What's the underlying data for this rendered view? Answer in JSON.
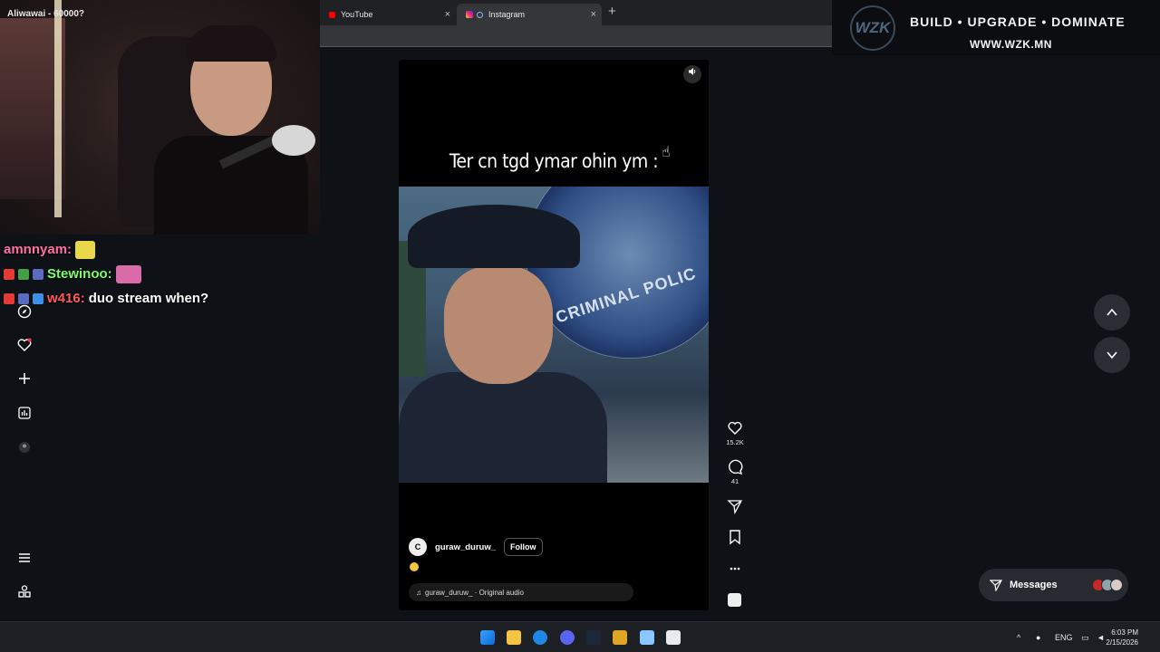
{
  "browser": {
    "tabs": [
      {
        "label": "YouTube",
        "icon": "youtube-icon"
      },
      {
        "label": "Instagram",
        "icon": "instagram-icon"
      }
    ],
    "new_tab": "+",
    "close": "×"
  },
  "webcam": {
    "overlay_text": "Aliwawai - 60000?"
  },
  "chat": {
    "messages": [
      {
        "user": "amnnyam:",
        "user_color": "#ff6fa3",
        "text": ""
      },
      {
        "user": "Stewinoo:",
        "user_color": "#7dff6a",
        "text": ""
      },
      {
        "user": "w416:",
        "user_color": "#ff5a5a",
        "text": "duo stream when?"
      }
    ]
  },
  "left_nav": {
    "icons": [
      "filter-icon",
      "search-icon",
      "compass-icon",
      "heart-icon",
      "plus-icon",
      "chart-icon",
      "profile-icon",
      "menu-icon",
      "grid-icon"
    ]
  },
  "reel": {
    "caption": "Ter cn tgd ymar ohin ym :",
    "video_sign_text": "CRIMINAL POLIC",
    "author": "guraw_duruw_",
    "follow_label": "Follow",
    "audio": "guraw_duruw_ · Original audio",
    "likes": "15.2K",
    "comments": "41"
  },
  "messages": {
    "label": "Messages"
  },
  "banner": {
    "logo": "WZK",
    "title": "BUILD • UPGRADE • DOMINATE",
    "url": "WWW.WZK.MN"
  },
  "taskbar": {
    "lang": "ENG",
    "time": "6:03 PM",
    "date": "2/15/2026"
  },
  "colors": {
    "accent_page": "#0e1217",
    "reel_bg": "#000000"
  }
}
